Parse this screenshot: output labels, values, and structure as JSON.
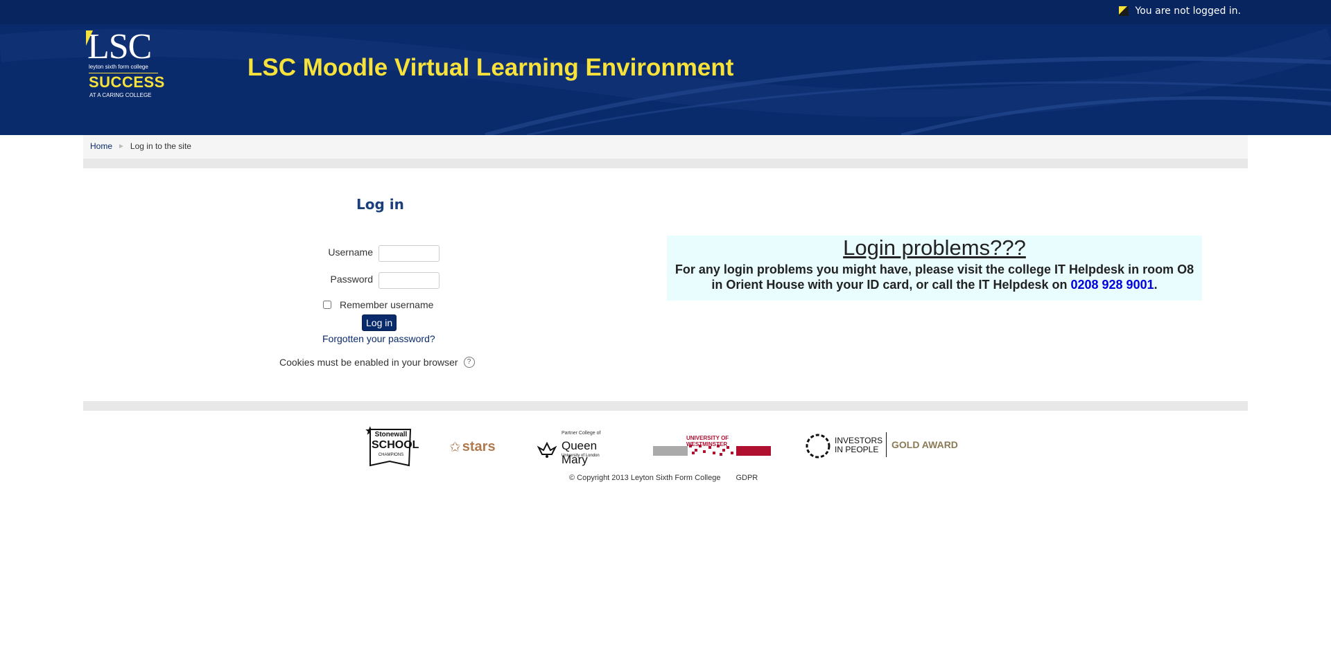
{
  "header": {
    "login_status": "You are not logged in.",
    "site_title": "LSC Moodle Virtual Learning Environment",
    "logo": {
      "main": "LSC",
      "sub": "leyton sixth form college",
      "success": "SUCCESS",
      "caring": "AT A CARING COLLEGE"
    }
  },
  "breadcrumb": {
    "home": "Home",
    "current": "Log in to the site",
    "separator": "►"
  },
  "login": {
    "title": "Log in",
    "username_label": "Username",
    "password_label": "Password",
    "remember_label": "Remember username",
    "submit_label": "Log in",
    "forgot_label": "Forgotten your password?",
    "cookies_text": "Cookies must be enabled in your browser",
    "help_icon": "?"
  },
  "notice": {
    "title": "Login problems???",
    "body": "For any login problems you might have, please visit the college IT Helpdesk in room O8 in Orient House with your ID card, or call the IT Helpdesk on",
    "phone": "0208 928 9001",
    "end": "."
  },
  "footer": {
    "logos": {
      "stonewall": [
        "Stonewall",
        "SCHOOL",
        "CHAMPIONS"
      ],
      "stars": "stars",
      "queen_mary": [
        "Partner College of",
        "Queen Mary",
        "University of London"
      ],
      "westminster": "UNIVERSITY OF WESTMINSTER",
      "iip": [
        "INVESTORS",
        "IN PEOPLE",
        "GOLD AWARD"
      ]
    },
    "copyright": "© Copyright 2013 Leyton Sixth Form College",
    "gdpr": "GDPR"
  },
  "colors": {
    "header_blue": "#0a2b6b",
    "title_yellow": "#f7e13b",
    "notice_bg": "#e9fdfe",
    "phone_blue": "#0000dd"
  }
}
